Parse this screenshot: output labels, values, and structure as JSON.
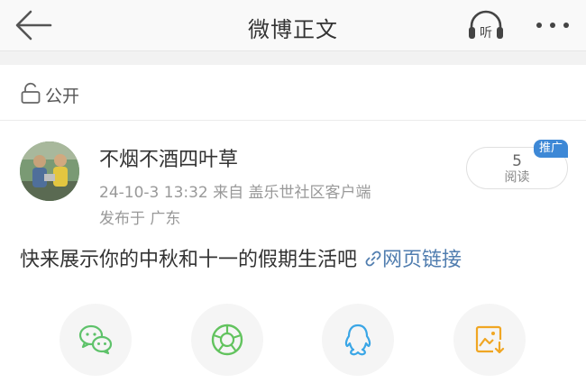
{
  "header": {
    "title": "微博正文",
    "back_icon": "back-arrow-icon",
    "listen_icon": "headphones-listen-icon",
    "listen_label": "听",
    "more_icon": "more-dots-icon"
  },
  "visibility": {
    "icon": "lock-open-icon",
    "label": "公开"
  },
  "post": {
    "username": "不烟不酒四叶草",
    "meta": "24-10-3 13:32  来自 盖乐世社区客户端",
    "location": "发布于 广东",
    "text": "快来展示你的中秋和十一的假期生活吧",
    "link_text": "网页链接",
    "read_count": "5",
    "read_label": "阅读",
    "promo_badge": "推广"
  },
  "share": [
    {
      "name": "wechat-share-button",
      "icon": "wechat-icon",
      "color": "#5ec26a"
    },
    {
      "name": "moments-share-button",
      "icon": "moments-icon",
      "color": "#62c35e"
    },
    {
      "name": "qq-share-button",
      "icon": "qq-icon",
      "color": "#3aa6e6"
    },
    {
      "name": "save-image-button",
      "icon": "save-image-icon",
      "color": "#f0a623"
    }
  ],
  "colors": {
    "link": "#507daf",
    "badge": "#3d88d6",
    "muted": "#999999"
  }
}
